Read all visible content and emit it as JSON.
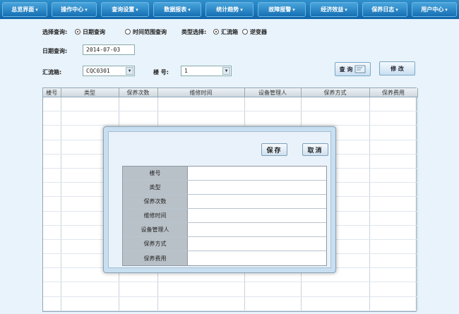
{
  "nav": {
    "items": [
      {
        "label": "总览界面"
      },
      {
        "label": "操作中心"
      },
      {
        "label": "查询设置"
      },
      {
        "label": "数据报表"
      },
      {
        "label": "统计趋势"
      },
      {
        "label": "故障报警"
      },
      {
        "label": "经济效益"
      },
      {
        "label": "保养日志"
      },
      {
        "label": "用户中心"
      }
    ],
    "caret": "▾"
  },
  "query": {
    "select_label": "选择查询:",
    "by_date_label": "日期查询",
    "by_range_label": "时间范围查询",
    "type_label": "类型选择:",
    "type_combiner_label": "汇流箱",
    "type_inverter_label": "逆变器",
    "date_label": "日期查询:",
    "date_value": "2014-07-03",
    "combiner_label": "汇流箱:",
    "combiner_value": "CQC0301",
    "building_label": "楼 号:",
    "building_value": "1",
    "query_button": "查 询",
    "edit_button": "修 改"
  },
  "grid": {
    "columns": [
      "楼号",
      "类型",
      "保养次数",
      "维修时间",
      "设备管理人",
      "保养方式",
      "保养费用"
    ]
  },
  "dialog": {
    "save_button": "保存",
    "cancel_button": "取消",
    "fields": [
      "楼号",
      "类型",
      "保养次数",
      "维修时间",
      "设备管理人",
      "保养方式",
      "保养费用"
    ]
  },
  "icons": {
    "select_arrow": "select-arrow-icon",
    "query_icon": "search-icon"
  },
  "colors": {
    "nav_top": "#2f90cc",
    "nav_bottom": "#0f65a8",
    "page_bg": "#e8f3fb",
    "dialog_bg": "#c8dff1"
  }
}
